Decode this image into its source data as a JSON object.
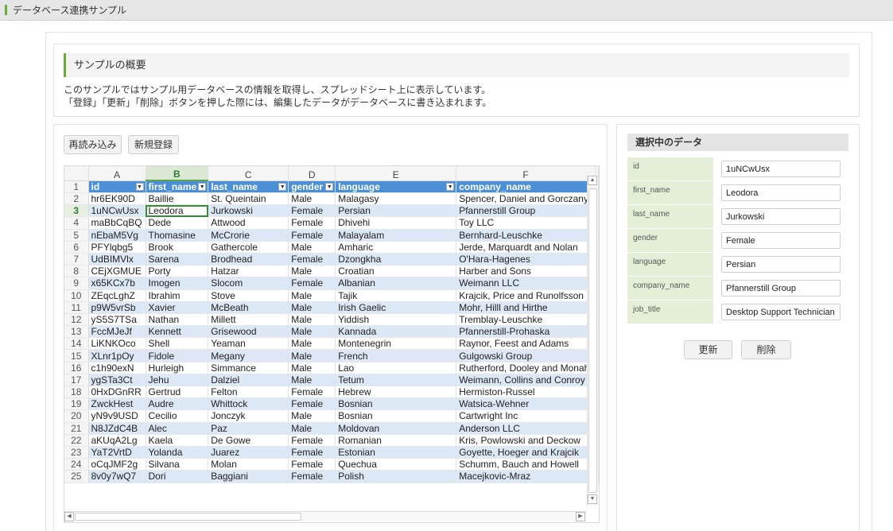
{
  "app": {
    "title": "データベース連携サンプル"
  },
  "overview": {
    "heading": "サンプルの概要",
    "line1": "このサンプルではサンプル用データベースの情報を取得し、スプレッドシート上に表示しています。",
    "line2": "「登録」「更新」「削除」ボタンを押した際には、編集したデータがデータベースに書き込まれます。"
  },
  "toolbar": {
    "reload_label": "再読み込み",
    "new_label": "新規登録"
  },
  "sheet": {
    "column_letters": [
      "A",
      "B",
      "C",
      "D",
      "E",
      "F"
    ],
    "selected_column": "B",
    "selected_row": 3,
    "header_row": [
      "id",
      "first_name",
      "last_name",
      "gender",
      "language",
      "company_name"
    ],
    "rows": [
      [
        "hr6EK90D",
        "Baillie",
        "St. Queintain",
        "Male",
        "Malagasy",
        "Spencer, Daniel and Gorczany"
      ],
      [
        "1uNCwUsx",
        "Leodora",
        "Jurkowski",
        "Female",
        "Persian",
        "Pfannerstill Group"
      ],
      [
        "maBbCqBQ",
        "Dede",
        "Attwood",
        "Female",
        "Dhivehi",
        "Toy LLC"
      ],
      [
        "nEbaM5Vg",
        "Thomasine",
        "McCrorie",
        "Female",
        "Malayalam",
        "Bernhard-Leuschke"
      ],
      [
        "PFYlqbg5",
        "Brook",
        "Gathercole",
        "Male",
        "Amharic",
        "Jerde, Marquardt and Nolan"
      ],
      [
        "UdBIMVlx",
        "Sarena",
        "Brodhead",
        "Female",
        "Dzongkha",
        "O'Hara-Hagenes"
      ],
      [
        "CEjXGMUE",
        "Porty",
        "Hatzar",
        "Male",
        "Croatian",
        "Harber and Sons"
      ],
      [
        "x65KCx7b",
        "Imogen",
        "Slocom",
        "Female",
        "Albanian",
        "Weimann LLC"
      ],
      [
        "ZEqcLghZ",
        "Ibrahim",
        "Stove",
        "Male",
        "Tajik",
        "Krajcik, Price and Runolfsson"
      ],
      [
        "p9W5vrSb",
        "Xavier",
        "McBeath",
        "Male",
        "Irish Gaelic",
        "Mohr, Hilll and Hirthe"
      ],
      [
        "yS5S7TSa",
        "Nathan",
        "Millett",
        "Male",
        "Yiddish",
        "Tremblay-Leuschke"
      ],
      [
        "FccMJeJf",
        "Kennett",
        "Grisewood",
        "Male",
        "Kannada",
        "Pfannerstill-Prohaska"
      ],
      [
        "LiKNKOco",
        "Shell",
        "Yeaman",
        "Male",
        "Montenegrin",
        "Raynor, Feest and Adams"
      ],
      [
        "XLnr1pOy",
        "Fidole",
        "Megany",
        "Male",
        "French",
        "Gulgowski Group"
      ],
      [
        "c1h90exN",
        "Hurleigh",
        "Simmance",
        "Male",
        "Lao",
        "Rutherford, Dooley and Monaha"
      ],
      [
        "ygSTa3Ct",
        "Jehu",
        "Dalziel",
        "Male",
        "Tetum",
        "Weimann, Collins and Conroy"
      ],
      [
        "0HxDGnRR",
        "Gertrud",
        "Felton",
        "Female",
        "Hebrew",
        "Hermiston-Russel"
      ],
      [
        "ZwckHest",
        "Audre",
        "Whittock",
        "Female",
        "Bosnian",
        "Watsica-Wehner"
      ],
      [
        "yN9v9USD",
        "Cecilio",
        "Jonczyk",
        "Male",
        "Bosnian",
        "Cartwright Inc"
      ],
      [
        "N8JZdC4B",
        "Alec",
        "Paz",
        "Male",
        "Moldovan",
        "Anderson LLC"
      ],
      [
        "aKUqA2Lg",
        "Kaela",
        "De Gowe",
        "Female",
        "Romanian",
        "Kris, Powlowski and Deckow"
      ],
      [
        "YaT2VrtD",
        "Yolanda",
        "Juarez",
        "Female",
        "Estonian",
        "Goyette, Hoeger and Krajcik"
      ],
      [
        "oCqJMF2g",
        "Silvana",
        "Molan",
        "Female",
        "Quechua",
        "Schumm, Bauch and Howell"
      ],
      [
        "8v0y7wQ7",
        "Dori",
        "Baggiani",
        "Female",
        "Polish",
        "Macejkovic-Mraz"
      ]
    ]
  },
  "selected": {
    "heading": "選択中のデータ",
    "fields": [
      {
        "label": "id",
        "value": "1uNCwUsx"
      },
      {
        "label": "first_name",
        "value": "Leodora"
      },
      {
        "label": "last_name",
        "value": "Jurkowski"
      },
      {
        "label": "gender",
        "value": "Female"
      },
      {
        "label": "language",
        "value": "Persian"
      },
      {
        "label": "company_name",
        "value": "Pfannerstill Group"
      },
      {
        "label": "job_title",
        "value": "Desktop Support Technician"
      }
    ],
    "update_label": "更新",
    "delete_label": "削除"
  },
  "colors": {
    "accent": "#6aaa3a",
    "header_blue": "#4b8fd6",
    "row_alt": "#dde8f6",
    "label_bg": "#e5efd8"
  },
  "icons": {
    "dropdown": "filter-dropdown-icon",
    "scroll_up": "scroll-up-icon",
    "scroll_down": "scroll-down-icon",
    "scroll_left": "scroll-left-icon",
    "scroll_right": "scroll-right-icon"
  }
}
